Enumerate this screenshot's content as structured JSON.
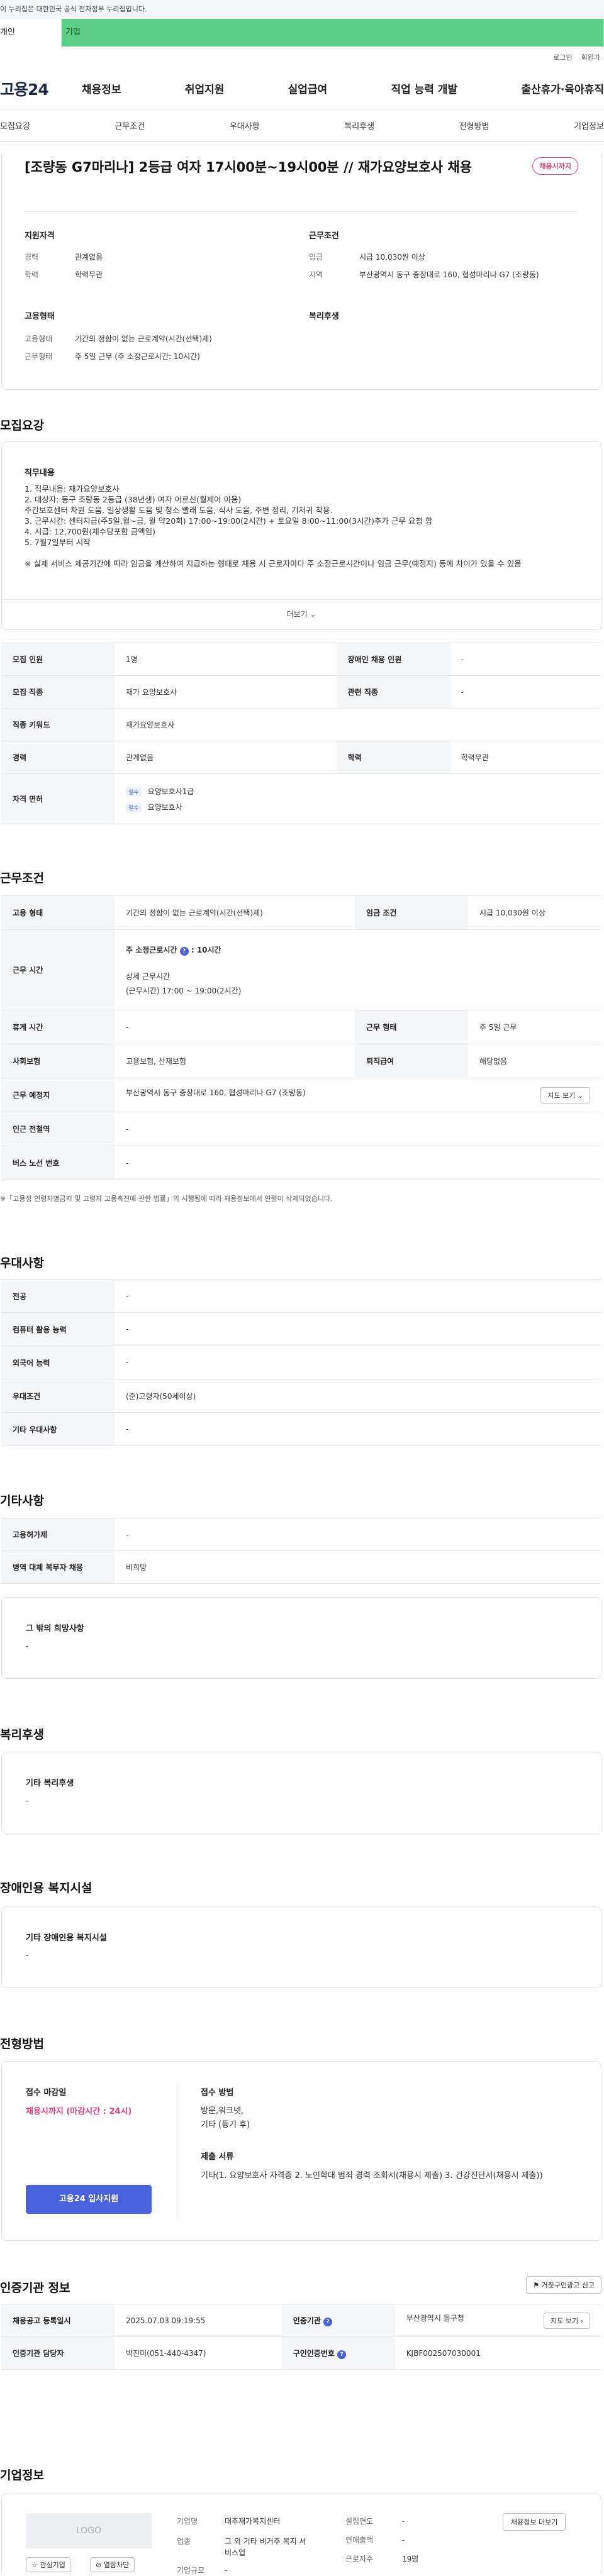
{
  "gov_bar": {
    "text": "이 누리집은 대한민국 공식 전자정부 누리집입니다."
  },
  "type_tabs": [
    "개인",
    "기업"
  ],
  "util": {
    "login": "로그인",
    "join": "회원가"
  },
  "gnb": {
    "logo": "고용24",
    "menu": [
      "채용정보",
      "취업지원",
      "실업급여",
      "직업 능력 개발",
      "출산휴가·육아휴직"
    ]
  },
  "sub_tabs": [
    "모집요강",
    "근무조건",
    "우대사항",
    "복리후생",
    "전형방법",
    "기업정보"
  ],
  "job": {
    "title": "[조량동 G7마리나] 2등급 여자 17시00분~19시00분 // 재가요양보호사 채용",
    "status": "채용시까지",
    "qual_head": "지원자격",
    "work_head": "근무조건",
    "emp_head": "고용형태",
    "welfare_head": "복리후생",
    "qual": [
      {
        "k": "경력",
        "v": "관계없음"
      },
      {
        "k": "학력",
        "v": "학력무관"
      }
    ],
    "work": [
      {
        "k": "임금",
        "v": "시급 10,030원 이상"
      },
      {
        "k": "지역",
        "v": "부산광역시 동구 중장대로 160, 협성마리나 G7 (조량동)"
      }
    ],
    "emp": [
      {
        "k": "고용형태",
        "v": "기간의 정함이 없는 근로계약(시간(선택)제)"
      },
      {
        "k": "근무형태",
        "v": "주 5일 근무 (주 소정근로시간: 10시간)"
      }
    ]
  },
  "recruit": {
    "section_title": "모집요강",
    "duty_head": "직무내용",
    "duty_lines": [
      "1. 직무내용: 재가요양보호사",
      "2. 대상자: 동구 조량동 2등급 (38년생) 여자 어르신(월제어 이용)",
      "주간보호센터 차원 도움, 일상생활 도움 및 청소 빨래 도움, 식사 도움, 주변 정리, 기저귀 착용.",
      "3. 근무시간: 센터지급(주5일,월~금, 월 약20회) 17:00~19:00(2시간) + 토요일 8:00~11:00(3시간)추가 근무 요청 함",
      "4. 시급: 12,700원(체수당포함 금액임)",
      "5. 7월7일부터 시작",
      "",
      "※ 실제 서비스 제공기간에 따라 임금을 계산하여 지급하는 형태로 채용 시 근로자마다 주 소정근로시간이나 임금 근무(예정지) 등에 차이가 있을 수 있음"
    ],
    "more": "더보기",
    "rows": {
      "count_k": "모집 인원",
      "count_v": "1명",
      "disabled_k": "장애인 채용 인원",
      "disabled_v": "-",
      "job_k": "모집 직종",
      "job_v": "재가 요양보호사",
      "related_k": "관련 직종",
      "related_v": "-",
      "keyword_k": "직종 키워드",
      "keyword_v": "재가요양보호사",
      "career_k": "경력",
      "career_v": "관계없음",
      "edu_k": "학력",
      "edu_v": "학력무관",
      "license_k": "자격 면허",
      "license_tag1": "필수",
      "license_v1": "요양보호사1급",
      "license_tag2": "필수",
      "license_v2": "요양보호사"
    }
  },
  "work": {
    "section_title": "근무조건",
    "emp_k": "고용 형태",
    "emp_v": "기간의 정함이 없는 근로계약(시간(선택)제)",
    "wage_k": "임금 조건",
    "wage_v": "시급 10,030원 이상",
    "hours_k": "근무 시간",
    "hours_weekly": "주 소정근로시간",
    "hours_weekly_v": "10시간",
    "hours_detail_h": "상세 근무시간",
    "hours_detail_v": "(근무시간) 17:00 ~ 19:00(2시간)",
    "rest_k": "휴게 시간",
    "rest_v": "-",
    "form_k": "근무 형태",
    "form_v": "주 5일 근무",
    "insure_k": "사회보험",
    "insure_v": "고용보험, 산재보험",
    "retire_k": "퇴직급여",
    "retire_v": "해당없음",
    "place_k": "근무 예정지",
    "place_v": "부산광역시 동구 중장대로 160, 협성마리나 G7 (조량동)",
    "map_btn": "지도 보기",
    "subway_k": "인근 전철역",
    "subway_v": "-",
    "bus_k": "버스 노선 번호",
    "bus_v": "-",
    "note": "※「고용정 연령차별금지 및 고령자 고용촉진에 관한 법률」의 시행됨에 따라 채용정보에서 연령이 삭제되었습니다."
  },
  "pref": {
    "section_title": "우대사항",
    "rows": [
      {
        "k": "전공",
        "v": "-"
      },
      {
        "k": "컴퓨터 활용 능력",
        "v": "-"
      },
      {
        "k": "외국어 능력",
        "v": "-"
      },
      {
        "k": "우대조건",
        "v": "(준)고령자(50세이상)"
      },
      {
        "k": "기타 우대사항",
        "v": "-"
      }
    ]
  },
  "etc": {
    "section_title": "기타사항",
    "rows": [
      {
        "k": "고용허가제",
        "v": "-"
      },
      {
        "k": "병역 대체 복무자 채용",
        "v": "비희망"
      }
    ],
    "hope_h": "그 밖의 희망사항",
    "hope_v": "-"
  },
  "welfare": {
    "section_title": "복리후생",
    "h": "기타 복리후생",
    "v": "-"
  },
  "disabled": {
    "section_title": "장애인용 복지시설",
    "h": "기타 장애인용 복지시설",
    "v": "-"
  },
  "process": {
    "section_title": "전형방법",
    "deadline_h": "접수 마감일",
    "deadline_v": "채용시까지 (마감시간 : 24시)",
    "method_h": "접수 방법",
    "method_v1": "방문,워크넷,",
    "method_v2": "기타 (등기 후)",
    "docs_h": "제출 서류",
    "docs_v": "기타(1. 요양보호사 자격증 2. 노인학대 범죄 경력 조회서(채용시 제출) 3. 건강진단서(채용시 제출))",
    "apply_btn": "고용24 입사지원"
  },
  "agency": {
    "section_title": "인증기관 정보",
    "report_btn": "거짓구인광고 신고",
    "reg_k": "채용공고 등록일시",
    "reg_v": "2025.07.03 09:19:55",
    "org_k": "인증기관",
    "org_v": "부산광역시 동구청",
    "map_btn": "지도 보기",
    "mgr_k": "인증기관 담당자",
    "mgr_v": "박진미(051-440-4347)",
    "no_k": "구인인증번호",
    "no_v": "KJBF002507030001"
  },
  "company": {
    "section_title": "기업정보",
    "logo": "LOGO",
    "fav_btn": "관심기업",
    "block_btn": "열람차단",
    "name_k": "기업명",
    "name_v": "대추재가복지센터",
    "industry_k": "업종",
    "industry_v": "그 외 기타 비거주 복지 서비스업",
    "size_k": "기업규모",
    "size_v": "-",
    "year_k": "설립연도",
    "year_v": "-",
    "sales_k": "연매출액",
    "sales_v": "-",
    "staff_k": "근로자수",
    "staff_v": "19명",
    "jobs_btn": "채용정보 더보기"
  }
}
